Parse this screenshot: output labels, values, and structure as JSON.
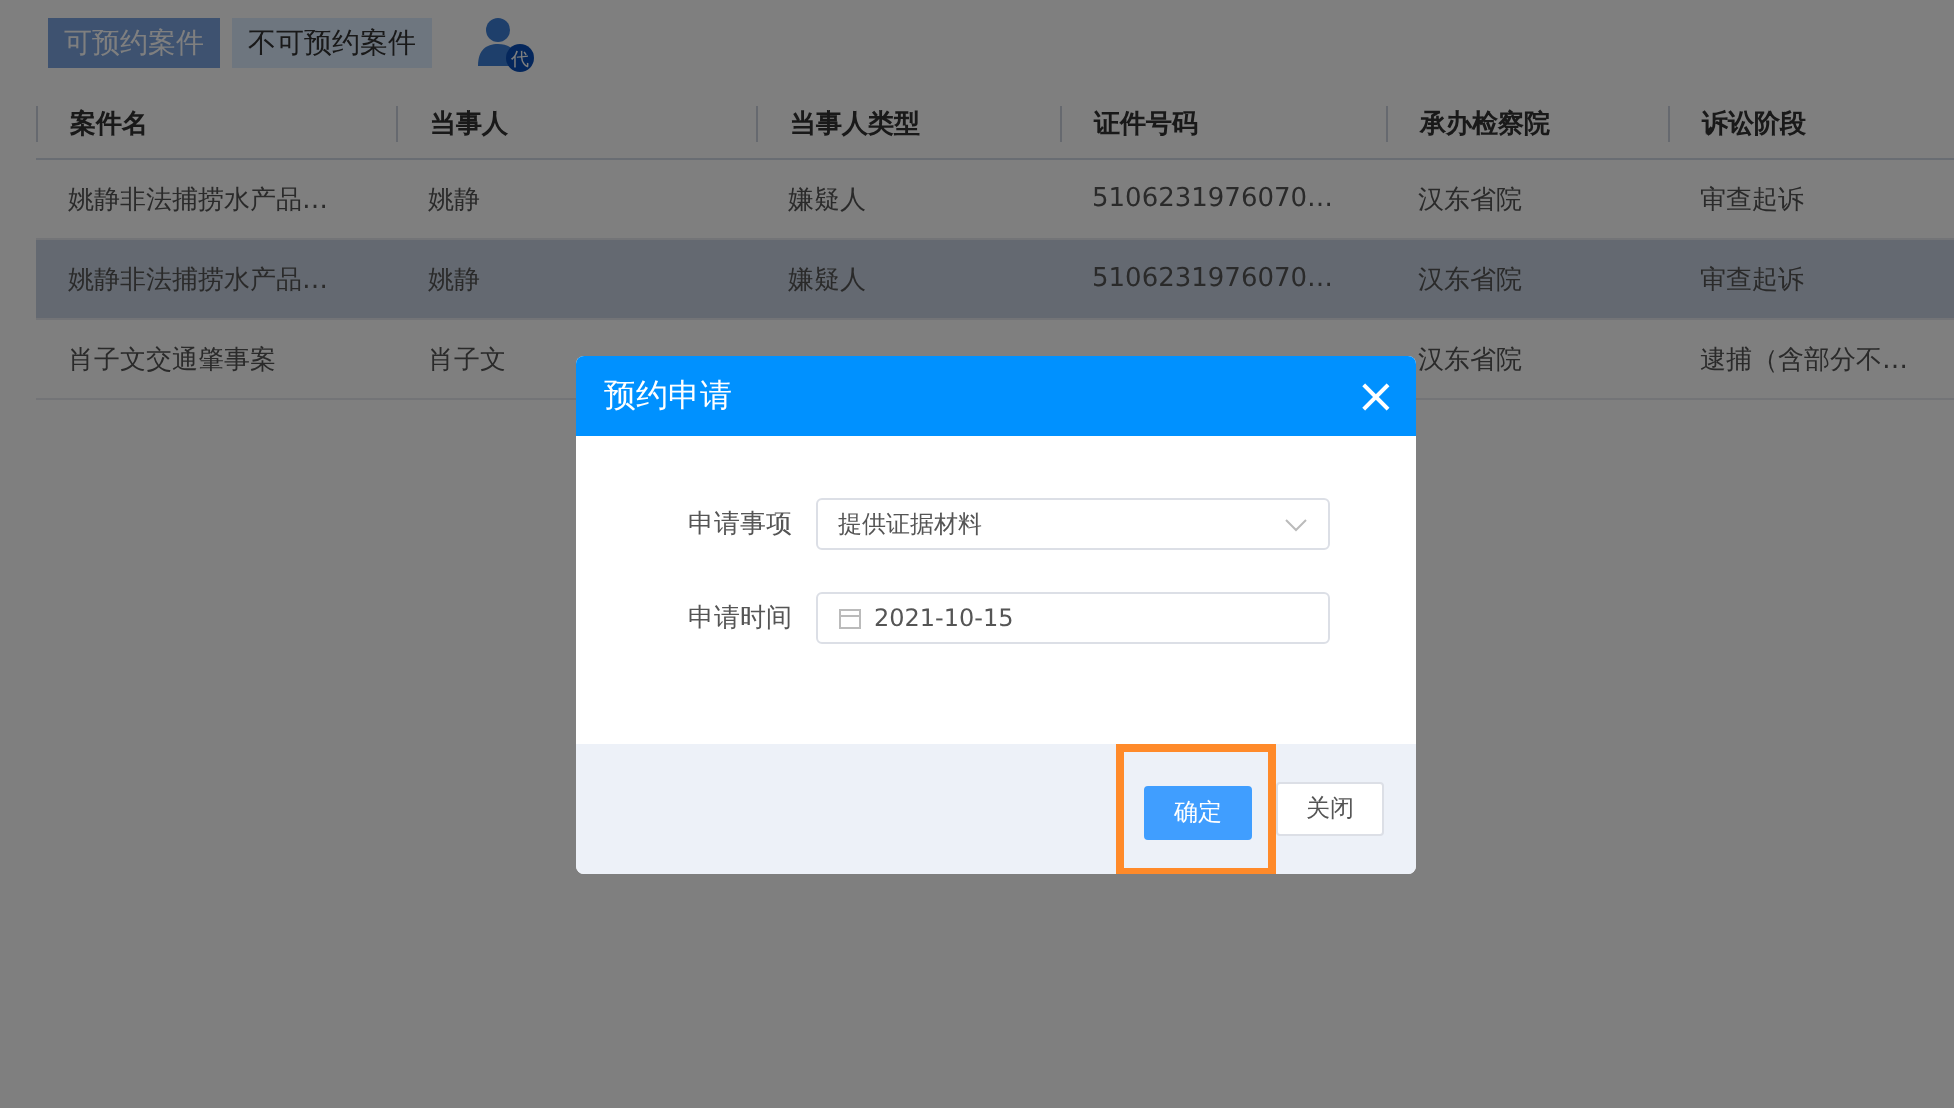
{
  "tabs": [
    {
      "label": "可预约案件",
      "selected": true
    },
    {
      "label": "不可预约案件",
      "selected": false
    }
  ],
  "agent_badge": "代",
  "table": {
    "columns": [
      "案件名",
      "当事人",
      "当事人类型",
      "证件号码",
      "承办检察院",
      "诉讼阶段"
    ],
    "rows": [
      {
        "selected": false,
        "cells": [
          "姚静非法捕捞水产品…",
          "姚静",
          "嫌疑人",
          "5106231976070…",
          "汉东省院",
          "审查起诉"
        ]
      },
      {
        "selected": true,
        "cells": [
          "姚静非法捕捞水产品…",
          "姚静",
          "嫌疑人",
          "5106231976070…",
          "汉东省院",
          "审查起诉"
        ]
      },
      {
        "selected": false,
        "cells": [
          "肖子文交通肇事案",
          "肖子文",
          null,
          null,
          "汉东省院",
          "逮捕（含部分不…"
        ]
      }
    ]
  },
  "dialog": {
    "title": "预约申请",
    "close": "×",
    "fields": [
      {
        "kind": "select",
        "label": "申请事项",
        "value": "提供证据材料"
      },
      {
        "kind": "date",
        "label": "申请时间",
        "value": "2021-10-15"
      }
    ],
    "buttons": [
      {
        "label": "确定",
        "primary": true,
        "highlighted": true
      },
      {
        "label": "关闭",
        "primary": false,
        "highlighted": false
      }
    ]
  }
}
